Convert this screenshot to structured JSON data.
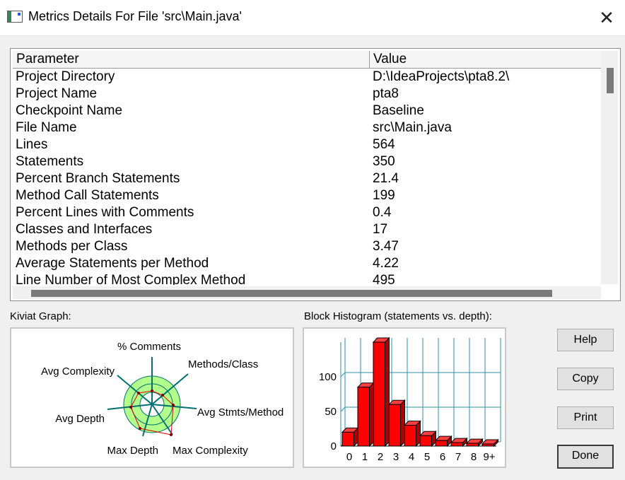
{
  "window": {
    "title": "Metrics Details For File 'src\\Main.java'",
    "close_glyph": "✕"
  },
  "table": {
    "columns": [
      "Parameter",
      "Value"
    ],
    "rows": [
      [
        "Project Directory",
        "D:\\IdeaProjects\\pta8.2\\"
      ],
      [
        "Project Name",
        "pta8"
      ],
      [
        "Checkpoint Name",
        "Baseline"
      ],
      [
        "File Name",
        "src\\Main.java"
      ],
      [
        "Lines",
        "564"
      ],
      [
        "Statements",
        "350"
      ],
      [
        "Percent Branch Statements",
        "21.4"
      ],
      [
        "Method Call Statements",
        "199"
      ],
      [
        "Percent Lines with Comments",
        "0.4"
      ],
      [
        "Classes and Interfaces",
        "17"
      ],
      [
        "Methods per Class",
        "3.47"
      ],
      [
        "Average Statements per Method",
        "4.22"
      ],
      [
        "Line Number of Most Complex Method",
        "495"
      ]
    ]
  },
  "kiviat": {
    "caption": "Kiviat Graph:",
    "axes": [
      "% Comments",
      "Methods/Class",
      "Avg Stmts/Method",
      "Max Complexity",
      "Max Depth",
      "Avg Depth",
      "Avg Complexity"
    ],
    "colors": {
      "ring": "#b3ff8c",
      "polygon": "#e00000",
      "axis": "#007070"
    }
  },
  "histogram": {
    "caption": "Block Histogram (statements vs. depth):",
    "categories": [
      "0",
      "1",
      "2",
      "3",
      "4",
      "5",
      "6",
      "7",
      "8",
      "9+"
    ],
    "values": [
      20,
      85,
      150,
      60,
      30,
      15,
      8,
      5,
      4,
      3
    ],
    "y_ticks": [
      "100",
      "50",
      "0"
    ],
    "bar_color": "#ff0000",
    "grid_color": "#2f8fa8"
  },
  "buttons": {
    "help": "Help",
    "copy": "Copy",
    "print": "Print",
    "done": "Done"
  }
}
